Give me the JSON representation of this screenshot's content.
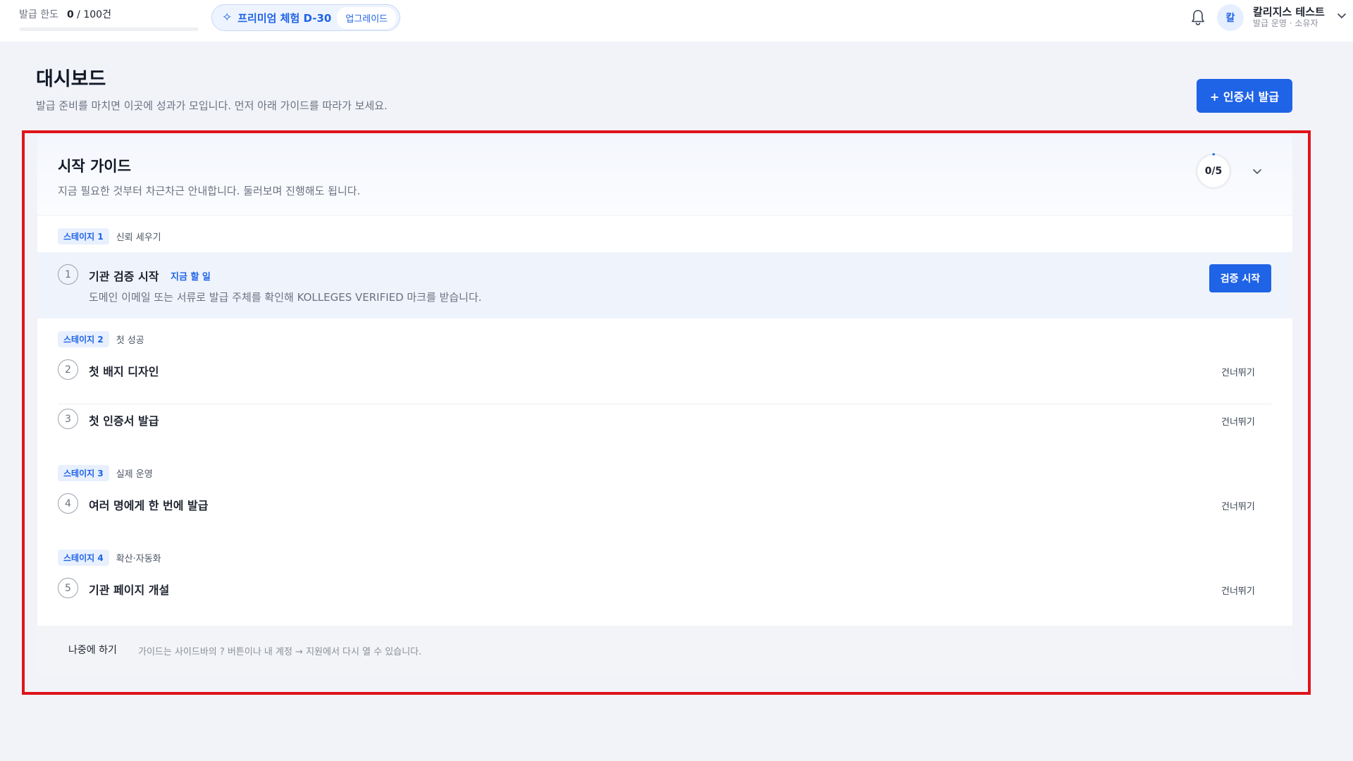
{
  "topbar": {
    "quota_label": "발급 한도",
    "quota_used": "0",
    "quota_total": " / 100건",
    "quota_fraction": 0,
    "trial_label": "프리미엄 체험 D-30",
    "upgrade_label": "업그레이드",
    "avatar_initial": "칼",
    "user_name": "칼리지스 테스트",
    "user_role": "발급 운영 · 소유자",
    "icons": [
      "sparkle-icon",
      "bell-icon",
      "chevron-down-icon"
    ]
  },
  "header": {
    "title": "대시보드",
    "subtitle": "발급 준비를 마치면 이곳에 성과가 모입니다. 먼저 아래 가이드를 따라가 보세요.",
    "issue_button": "+ 인증서 발급"
  },
  "guide": {
    "title": "시작 가이드",
    "subtitle": "지금 필요한 것부터 차근차근 안내합니다. 둘러보며 진행해도 됩니다.",
    "progress_text": "0/5",
    "progress_done": 0,
    "progress_total": 5,
    "stages": [
      {
        "badge": "스테이지 1",
        "name": "신뢰 세우기"
      },
      {
        "badge": "스테이지 2",
        "name": "첫 성공"
      },
      {
        "badge": "스테이지 3",
        "name": "실제 운영"
      },
      {
        "badge": "스테이지 4",
        "name": "확산·자동화"
      }
    ],
    "steps": [
      {
        "num": "1",
        "title": "기관 검증 시작",
        "tag": "지금 할 일",
        "desc": "도메인 이메일 또는 서류로 발급 주체를 확인해 KOLLEGES VERIFIED 마크를 받습니다.",
        "action": "검증 시작"
      },
      {
        "num": "2",
        "title": "첫 배지 디자인",
        "action": "건너뛰기"
      },
      {
        "num": "3",
        "title": "첫 인증서 발급",
        "action": "건너뛰기"
      },
      {
        "num": "4",
        "title": "여러 명에게 한 번에 발급",
        "action": "건너뛰기"
      },
      {
        "num": "5",
        "title": "기관 페이지 개설",
        "action": "건너뛰기"
      }
    ],
    "footer": {
      "later_label": "나중에 하기",
      "note": "가이드는 사이드바의 ? 버튼이나 내 계정 → 지원에서 다시 열 수 있습니다."
    }
  },
  "colors": {
    "accent": "#1f63e6",
    "highlight": "#e0131a",
    "background": "#f1f3f8"
  }
}
